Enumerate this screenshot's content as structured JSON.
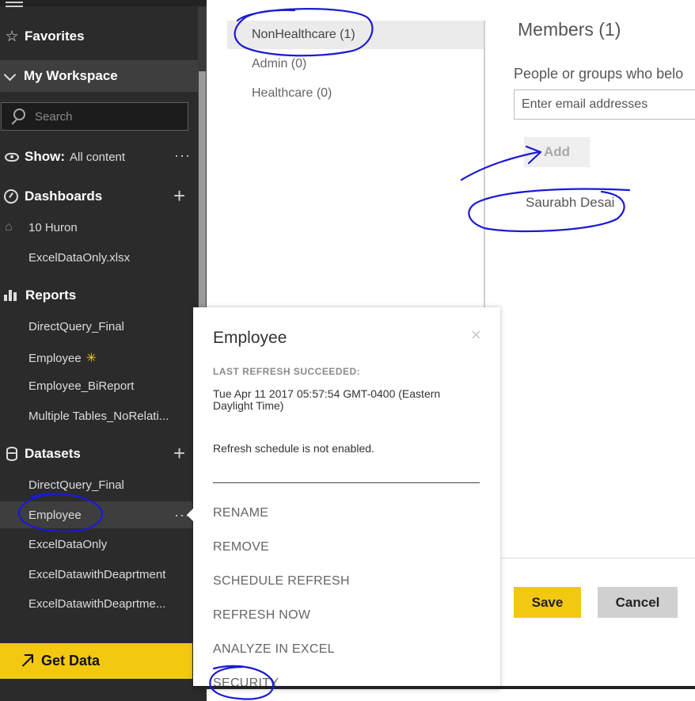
{
  "sidebar": {
    "favorites": "Favorites",
    "workspace": "My Workspace",
    "search_placeholder": "Search",
    "show_label": "Show:",
    "show_value": "All content",
    "dashboards": {
      "header": "Dashboards",
      "items": [
        "10 Huron",
        "ExcelDataOnly.xlsx"
      ]
    },
    "reports": {
      "header": "Reports",
      "items": [
        "DirectQuery_Final",
        "Employee",
        "Employee_BiReport",
        "Multiple Tables_NoRelati..."
      ]
    },
    "datasets": {
      "header": "Datasets",
      "items": [
        "DirectQuery_Final",
        "Employee",
        "ExcelDataOnly",
        "ExcelDatawithDeaprtment",
        "ExcelDatawithDeaprtme..."
      ]
    },
    "new_marker": "✳",
    "get_data": "Get Data"
  },
  "roles": [
    {
      "label": "NonHealthcare (1)",
      "selected": true
    },
    {
      "label": "Admin (0)",
      "selected": false
    },
    {
      "label": "Healthcare (0)",
      "selected": false
    }
  ],
  "members": {
    "title": "Members (1)",
    "subtitle": "People or groups who belo",
    "email_placeholder": "Enter email addresses",
    "add": "Add",
    "list": [
      "Saurabh Desai"
    ]
  },
  "actions": {
    "save": "Save",
    "cancel": "Cancel"
  },
  "flyout": {
    "title": "Employee",
    "close": "×",
    "refresh_caption": "LAST REFRESH SUCCEEDED:",
    "refresh_time": "Tue Apr 11 2017 05:57:54 GMT-0400 (Eastern Daylight Time)",
    "schedule_status": "Refresh schedule is not enabled.",
    "menu": [
      "RENAME",
      "REMOVE",
      "SCHEDULE REFRESH",
      "REFRESH NOW",
      "ANALYZE IN EXCEL",
      "SECURITY"
    ]
  },
  "colors": {
    "sidebar_bg": "#2b2b2b",
    "accent_yellow": "#f2c811",
    "annotation_ink": "#1a1ad6"
  },
  "icons": [
    "hamburger-icon",
    "star-icon",
    "chevron-down-icon",
    "search-icon",
    "eye-icon",
    "more-icon",
    "gauge-icon",
    "plus-icon",
    "bar-chart-icon",
    "database-icon",
    "arrow-up-right-icon",
    "close-icon"
  ]
}
